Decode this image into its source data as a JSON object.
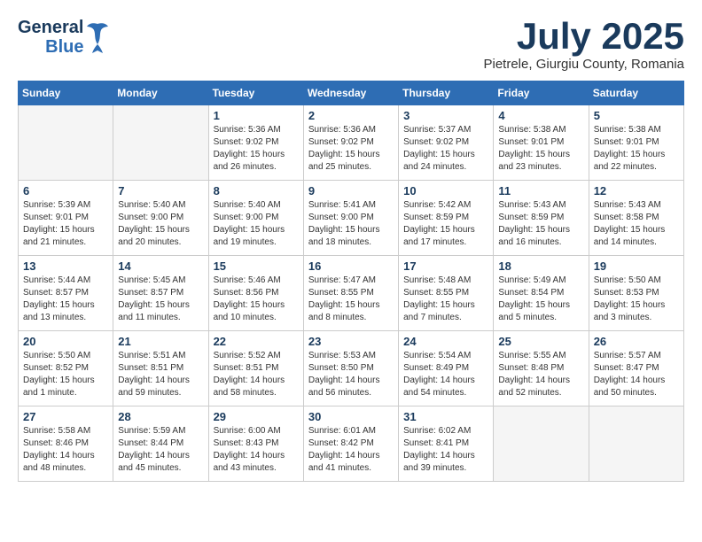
{
  "header": {
    "logo_line1": "General",
    "logo_line2": "Blue",
    "month": "July 2025",
    "location": "Pietrele, Giurgiu County, Romania"
  },
  "weekdays": [
    "Sunday",
    "Monday",
    "Tuesday",
    "Wednesday",
    "Thursday",
    "Friday",
    "Saturday"
  ],
  "weeks": [
    [
      {
        "day": "",
        "info": ""
      },
      {
        "day": "",
        "info": ""
      },
      {
        "day": "1",
        "info": "Sunrise: 5:36 AM\nSunset: 9:02 PM\nDaylight: 15 hours and 26 minutes."
      },
      {
        "day": "2",
        "info": "Sunrise: 5:36 AM\nSunset: 9:02 PM\nDaylight: 15 hours and 25 minutes."
      },
      {
        "day": "3",
        "info": "Sunrise: 5:37 AM\nSunset: 9:02 PM\nDaylight: 15 hours and 24 minutes."
      },
      {
        "day": "4",
        "info": "Sunrise: 5:38 AM\nSunset: 9:01 PM\nDaylight: 15 hours and 23 minutes."
      },
      {
        "day": "5",
        "info": "Sunrise: 5:38 AM\nSunset: 9:01 PM\nDaylight: 15 hours and 22 minutes."
      }
    ],
    [
      {
        "day": "6",
        "info": "Sunrise: 5:39 AM\nSunset: 9:01 PM\nDaylight: 15 hours and 21 minutes."
      },
      {
        "day": "7",
        "info": "Sunrise: 5:40 AM\nSunset: 9:00 PM\nDaylight: 15 hours and 20 minutes."
      },
      {
        "day": "8",
        "info": "Sunrise: 5:40 AM\nSunset: 9:00 PM\nDaylight: 15 hours and 19 minutes."
      },
      {
        "day": "9",
        "info": "Sunrise: 5:41 AM\nSunset: 9:00 PM\nDaylight: 15 hours and 18 minutes."
      },
      {
        "day": "10",
        "info": "Sunrise: 5:42 AM\nSunset: 8:59 PM\nDaylight: 15 hours and 17 minutes."
      },
      {
        "day": "11",
        "info": "Sunrise: 5:43 AM\nSunset: 8:59 PM\nDaylight: 15 hours and 16 minutes."
      },
      {
        "day": "12",
        "info": "Sunrise: 5:43 AM\nSunset: 8:58 PM\nDaylight: 15 hours and 14 minutes."
      }
    ],
    [
      {
        "day": "13",
        "info": "Sunrise: 5:44 AM\nSunset: 8:57 PM\nDaylight: 15 hours and 13 minutes."
      },
      {
        "day": "14",
        "info": "Sunrise: 5:45 AM\nSunset: 8:57 PM\nDaylight: 15 hours and 11 minutes."
      },
      {
        "day": "15",
        "info": "Sunrise: 5:46 AM\nSunset: 8:56 PM\nDaylight: 15 hours and 10 minutes."
      },
      {
        "day": "16",
        "info": "Sunrise: 5:47 AM\nSunset: 8:55 PM\nDaylight: 15 hours and 8 minutes."
      },
      {
        "day": "17",
        "info": "Sunrise: 5:48 AM\nSunset: 8:55 PM\nDaylight: 15 hours and 7 minutes."
      },
      {
        "day": "18",
        "info": "Sunrise: 5:49 AM\nSunset: 8:54 PM\nDaylight: 15 hours and 5 minutes."
      },
      {
        "day": "19",
        "info": "Sunrise: 5:50 AM\nSunset: 8:53 PM\nDaylight: 15 hours and 3 minutes."
      }
    ],
    [
      {
        "day": "20",
        "info": "Sunrise: 5:50 AM\nSunset: 8:52 PM\nDaylight: 15 hours and 1 minute."
      },
      {
        "day": "21",
        "info": "Sunrise: 5:51 AM\nSunset: 8:51 PM\nDaylight: 14 hours and 59 minutes."
      },
      {
        "day": "22",
        "info": "Sunrise: 5:52 AM\nSunset: 8:51 PM\nDaylight: 14 hours and 58 minutes."
      },
      {
        "day": "23",
        "info": "Sunrise: 5:53 AM\nSunset: 8:50 PM\nDaylight: 14 hours and 56 minutes."
      },
      {
        "day": "24",
        "info": "Sunrise: 5:54 AM\nSunset: 8:49 PM\nDaylight: 14 hours and 54 minutes."
      },
      {
        "day": "25",
        "info": "Sunrise: 5:55 AM\nSunset: 8:48 PM\nDaylight: 14 hours and 52 minutes."
      },
      {
        "day": "26",
        "info": "Sunrise: 5:57 AM\nSunset: 8:47 PM\nDaylight: 14 hours and 50 minutes."
      }
    ],
    [
      {
        "day": "27",
        "info": "Sunrise: 5:58 AM\nSunset: 8:46 PM\nDaylight: 14 hours and 48 minutes."
      },
      {
        "day": "28",
        "info": "Sunrise: 5:59 AM\nSunset: 8:44 PM\nDaylight: 14 hours and 45 minutes."
      },
      {
        "day": "29",
        "info": "Sunrise: 6:00 AM\nSunset: 8:43 PM\nDaylight: 14 hours and 43 minutes."
      },
      {
        "day": "30",
        "info": "Sunrise: 6:01 AM\nSunset: 8:42 PM\nDaylight: 14 hours and 41 minutes."
      },
      {
        "day": "31",
        "info": "Sunrise: 6:02 AM\nSunset: 8:41 PM\nDaylight: 14 hours and 39 minutes."
      },
      {
        "day": "",
        "info": ""
      },
      {
        "day": "",
        "info": ""
      }
    ]
  ]
}
